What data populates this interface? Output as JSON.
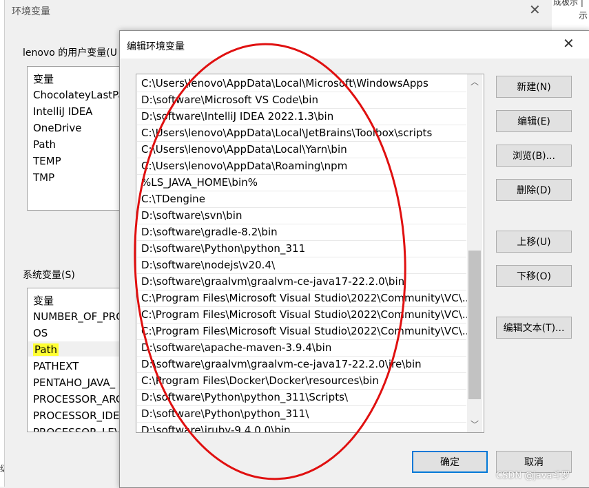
{
  "outer_dialog": {
    "title": "环境变量",
    "user_group_label": "lenovo 的用户变量(U",
    "user_vars_header": "变量",
    "user_vars": [
      "ChocolateyLastPa",
      "IntelliJ IDEA",
      "OneDrive",
      "Path",
      "TEMP",
      "TMP"
    ],
    "system_group_label": "系统变量(S)",
    "system_vars_header": "变量",
    "system_vars": [
      "NUMBER_OF_PRO",
      "OS",
      "Path",
      "PATHEXT",
      "PENTAHO_JAVA_",
      "PROCESSOR_ARC",
      "PROCESSOR_IDEN",
      "PROCESSOR_LEVE"
    ],
    "highlighted_var": "Path"
  },
  "background_window": {
    "text_top": "成板示 |",
    "text_side1": "示",
    "text_side2": "级"
  },
  "edit_dialog": {
    "title": "编辑环境变量",
    "paths": [
      "C:\\Users\\lenovo\\AppData\\Local\\Microsoft\\WindowsApps",
      "D:\\software\\Microsoft VS Code\\bin",
      "D:\\software\\IntelliJ IDEA 2022.1.3\\bin",
      "C:\\Users\\lenovo\\AppData\\Local\\JetBrains\\Toolbox\\scripts",
      "C:\\Users\\lenovo\\AppData\\Local\\Yarn\\bin",
      "C:\\Users\\lenovo\\AppData\\Roaming\\npm",
      "%LS_JAVA_HOME\\bin%",
      "C:\\TDengine",
      "D:\\software\\svn\\bin",
      "D:\\software\\gradle-8.2\\bin",
      "D:\\software\\Python\\python_311",
      "D:\\software\\nodejs\\v20.4\\",
      "D:\\software\\graalvm\\graalvm-ce-java17-22.2.0\\bin",
      "C:\\Program Files\\Microsoft Visual Studio\\2022\\Community\\VC\\...",
      "C:\\Program Files\\Microsoft Visual Studio\\2022\\Community\\VC\\...",
      "C:\\Program Files\\Microsoft Visual Studio\\2022\\Community\\VC\\...",
      "D:\\software\\apache-maven-3.9.4\\bin",
      "D:\\software\\graalvm\\graalvm-ce-java17-22.2.0\\jre\\bin",
      "C:\\Program Files\\Docker\\Docker\\resources\\bin",
      "D:\\software\\Python\\python_311\\Scripts\\",
      "D:\\software\\Python\\python_311\\",
      "D:\\software\\jruby-9.4.0.0\\bin"
    ],
    "buttons": {
      "new": "新建(N)",
      "edit": "编辑(E)",
      "browse": "浏览(B)...",
      "delete": "删除(D)",
      "move_up": "上移(U)",
      "move_down": "下移(O)",
      "edit_text": "编辑文本(T)...",
      "ok": "确定",
      "cancel": "取消"
    },
    "annotation_color": "#e01010"
  },
  "watermark": "CSDN @java斗罗"
}
